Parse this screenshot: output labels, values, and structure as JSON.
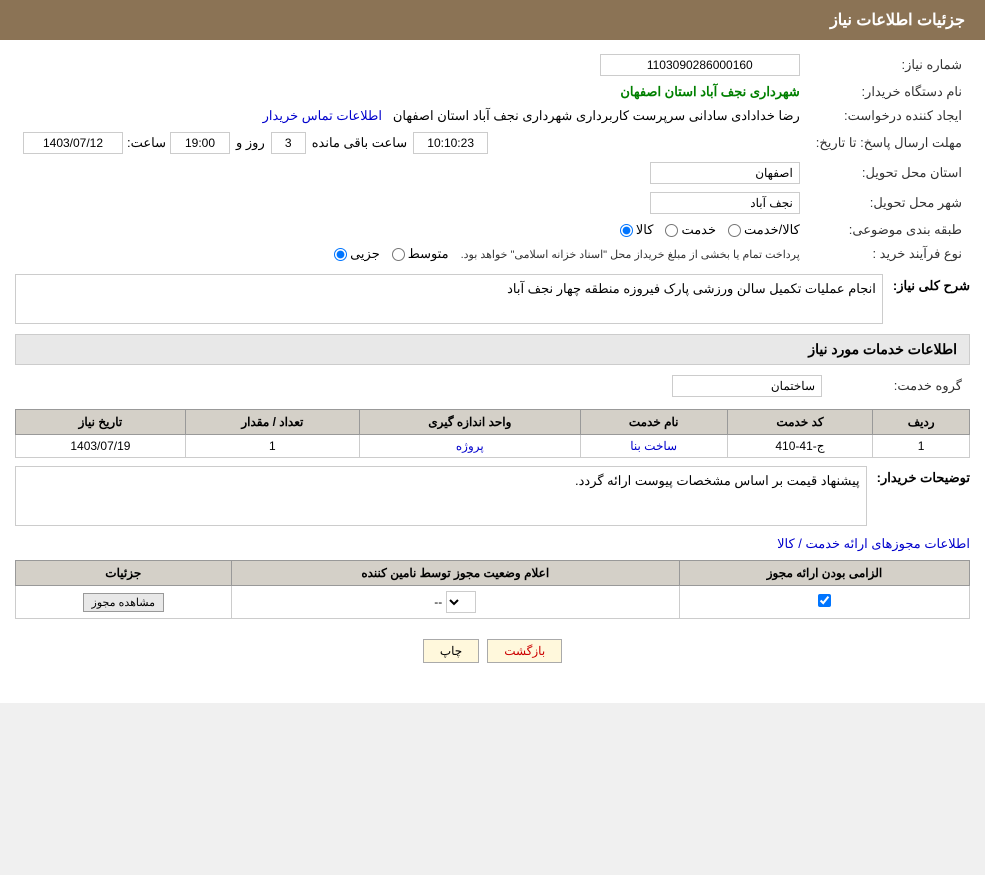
{
  "header": {
    "title": "جزئیات اطلاعات نیاز"
  },
  "fields": {
    "need_number_label": "شماره نیاز:",
    "need_number_value": "1103090286000160",
    "buyer_org_label": "نام دستگاه خریدار:",
    "buyer_org_value": "شهرداری نجف آباد استان اصفهان",
    "requester_label": "ایجاد کننده درخواست:",
    "requester_value": "رضا خدادادی سادانی سرپرست  کاربرداری شهرداری نجف آباد استان اصفهان",
    "contact_link": "اطلاعات تماس خریدار",
    "deadline_label": "مهلت ارسال پاسخ: تا تاریخ:",
    "deadline_date": "1403/07/12",
    "deadline_time_label": "ساعت:",
    "deadline_time": "19:00",
    "deadline_days_label": "روز و",
    "deadline_days": "3",
    "deadline_remaining_label": "ساعت باقی مانده",
    "deadline_remaining": "10:10:23",
    "province_label": "استان محل تحویل:",
    "province_value": "اصفهان",
    "city_label": "شهر محل تحویل:",
    "city_value": "نجف آباد",
    "category_label": "طبقه بندی موضوعی:",
    "category_kala": "کالا",
    "category_khadamat": "خدمت",
    "category_kala_khadamat": "کالا/خدمت",
    "purchase_type_label": "نوع فرآیند خرید :",
    "purchase_jozyi": "جزیی",
    "purchase_motavaset": "متوسط",
    "purchase_note": "پرداخت تمام یا بخشی از مبلغ خریداز محل \"اسناد خزانه اسلامی\" خواهد بود.",
    "need_description_label": "شرح کلی نیاز:",
    "need_description_value": "انجام عملیات تکمیل سالن ورزشی پارک فیروزه منطقه چهار نجف آباد",
    "services_section_label": "اطلاعات خدمات مورد نیاز",
    "service_group_label": "گروه خدمت:",
    "service_group_value": "ساختمان",
    "table_headers": {
      "radif": "ردیف",
      "code": "کد خدمت",
      "name": "نام خدمت",
      "unit": "واحد اندازه گیری",
      "count": "تعداد / مقدار",
      "date": "تاریخ نیاز"
    },
    "table_rows": [
      {
        "radif": "1",
        "code": "ج-41-410",
        "name": "ساخت بنا",
        "unit": "پروژه",
        "count": "1",
        "date": "1403/07/19"
      }
    ],
    "buyer_notes_label": "توضیحات خریدار:",
    "buyer_notes_value": "پیشنهاد قیمت بر اساس مشخصات پیوست ارائه گردد.",
    "permissions_link": "اطلاعات مجوزهای ارائه خدمت / کالا",
    "permissions_table": {
      "col1": "الزامی بودن ارائه مجوز",
      "col2": "اعلام وضعیت مجوز توسط نامین کننده",
      "col3": "جزئیات"
    },
    "permissions_row": {
      "mandatory": true,
      "status": "--",
      "details_btn": "مشاهده مجوز"
    }
  },
  "buttons": {
    "print": "چاپ",
    "back": "بازگشت"
  }
}
